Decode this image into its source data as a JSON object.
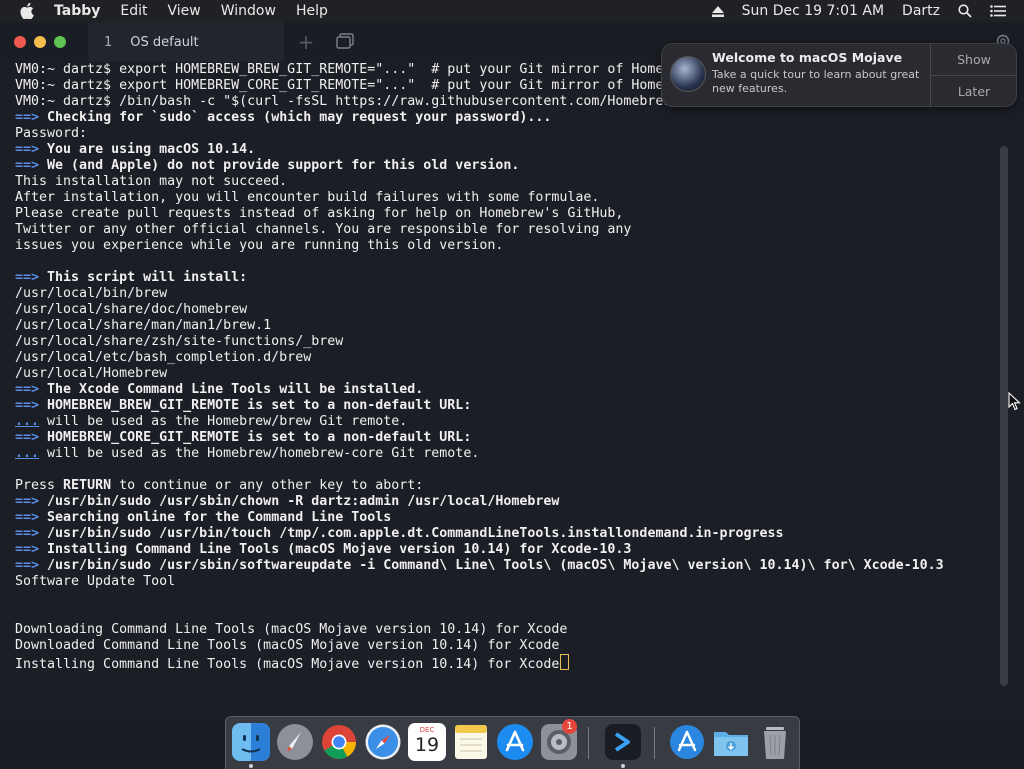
{
  "menubar": {
    "app_name": "Tabby",
    "items": [
      "Edit",
      "View",
      "Window",
      "Help"
    ],
    "datetime": "Sun Dec 19  7:01 AM",
    "user": "Dartz"
  },
  "window": {
    "tab_number": "1",
    "tab_title": "OS default",
    "tab_add": "+"
  },
  "notification": {
    "title": "Welcome to macOS Mojave",
    "body": "Take a quick tour to learn about great new features.",
    "show_label": "Show",
    "later_label": "Later"
  },
  "terminal": {
    "lines": [
      "VM0:~ dartz$ export HOMEBREW_BREW_GIT_REMOTE=\"...\"  # put your Git mirror of Home",
      "VM0:~ dartz$ export HOMEBREW_CORE_GIT_REMOTE=\"...\"  # put your Git mirror of Home",
      "VM0:~ dartz$ /bin/bash -c \"$(curl -fsSL https://raw.githubusercontent.com/Homebrew/install/master/install.sh)\"",
      "==> Checking for `sudo` access (which may request your password)...",
      "Password:",
      "==> You are using macOS 10.14.",
      "==> We (and Apple) do not provide support for this old version.",
      "This installation may not succeed.",
      "After installation, you will encounter build failures with some formulae.",
      "Please create pull requests instead of asking for help on Homebrew's GitHub,",
      "Twitter or any other official channels. You are responsible for resolving any",
      "issues you experience while you are running this old version.",
      "",
      "==> This script will install:",
      "/usr/local/bin/brew",
      "/usr/local/share/doc/homebrew",
      "/usr/local/share/man/man1/brew.1",
      "/usr/local/share/zsh/site-functions/_brew",
      "/usr/local/etc/bash_completion.d/brew",
      "/usr/local/Homebrew",
      "==> The Xcode Command Line Tools will be installed.",
      "==> HOMEBREW_BREW_GIT_REMOTE is set to a non-default URL:",
      "... will be used as the Homebrew/brew Git remote.",
      "==> HOMEBREW_CORE_GIT_REMOTE is set to a non-default URL:",
      "... will be used as the Homebrew/homebrew-core Git remote.",
      "",
      "Press RETURN to continue or any other key to abort:",
      "==> /usr/bin/sudo /usr/sbin/chown -R dartz:admin /usr/local/Homebrew",
      "==> Searching online for the Command Line Tools",
      "==> /usr/bin/sudo /usr/bin/touch /tmp/.com.apple.dt.CommandLineTools.installondemand.in-progress",
      "==> Installing Command Line Tools (macOS Mojave version 10.14) for Xcode-10.3",
      "==> /usr/bin/sudo /usr/sbin/softwareupdate -i Command\\ Line\\ Tools\\ (macOS\\ Mojave\\ version\\ 10.14)\\ for\\ Xcode-10.3",
      "Software Update Tool",
      "",
      "",
      "Downloading Command Line Tools (macOS Mojave version 10.14) for Xcode",
      "Downloaded Command Line Tools (macOS Mojave version 10.14) for Xcode",
      "Installing Command Line Tools (macOS Mojave version 10.14) for Xcode"
    ]
  },
  "dock": {
    "calendar_month": "DEC",
    "calendar_day": "19",
    "settings_badge": "1",
    "icons": [
      "finder-icon",
      "launchpad-icon",
      "chrome-icon",
      "safari-icon",
      "calendar-icon",
      "notes-icon",
      "app-store-icon",
      "system-preferences-icon",
      "tabby-icon",
      "applications-folder-icon",
      "downloads-folder-icon",
      "trash-icon"
    ]
  },
  "colors": {
    "arrow": "#5a8ee8",
    "terminal_bg": "#1c1e26",
    "cursor": "#e8c05a"
  }
}
